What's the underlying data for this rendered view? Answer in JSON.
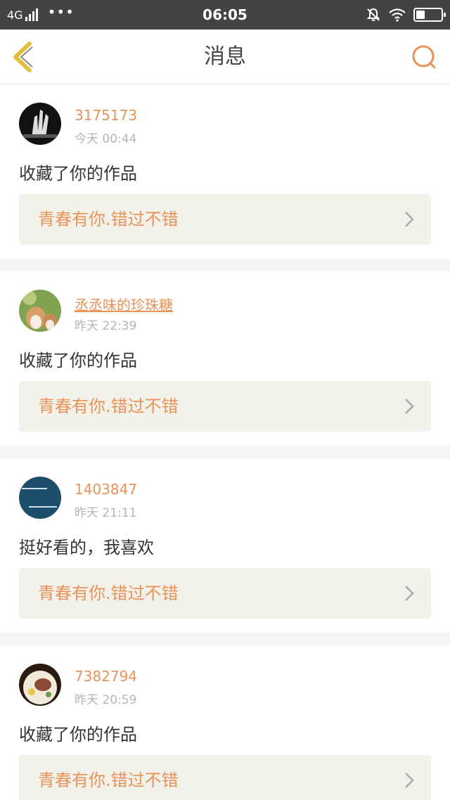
{
  "status_bar": {
    "network": "4G",
    "dots": "•••",
    "time": "06:05"
  },
  "header": {
    "title": "消息"
  },
  "colors": {
    "accent": "#e8935a",
    "back_arrow": "#e2c13a",
    "status_bar_bg": "#434343",
    "work_card_bg": "#f2f2ea"
  },
  "messages": [
    {
      "username": "3175173",
      "time": "今天 00:44",
      "text": "收藏了你的作品",
      "work_title": "青春有你.错过不错"
    },
    {
      "username": "丞丞味的珍珠糖",
      "time": "昨天 22:39",
      "text": "收藏了你的作品",
      "work_title": "青春有你.错过不错"
    },
    {
      "username": "1403847",
      "time": "昨天 21:11",
      "text": "挺好看的，我喜欢",
      "work_title": "青春有你.错过不错"
    },
    {
      "username": "7382794",
      "time": "昨天 20:59",
      "text": "收藏了你的作品",
      "work_title": "青春有你.错过不错"
    }
  ]
}
